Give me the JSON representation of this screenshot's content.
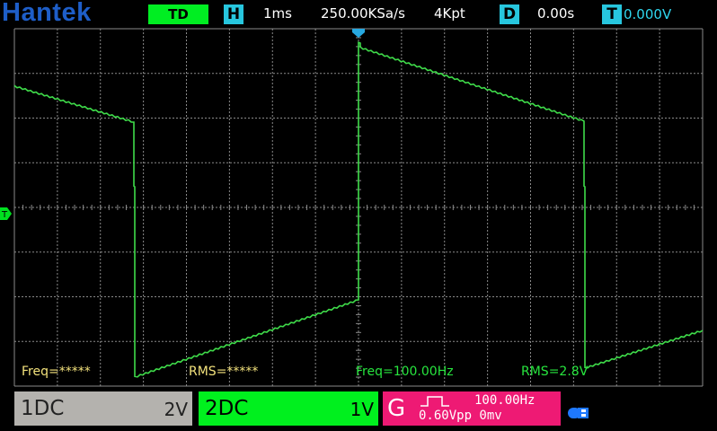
{
  "header": {
    "brand": "Hantek",
    "mode": "TD",
    "timebase_letter": "H",
    "timebase": "1ms",
    "sample_rate": "250.00KSa/s",
    "memory_depth": "4Kpt",
    "delay_letter": "D",
    "delay": "0.00s",
    "trigger_letter": "T",
    "trigger_level": "0.000V"
  },
  "measurements": {
    "ch1_freq": "Freq=*****",
    "ch1_rms": "RMS=*****",
    "ch2_freq": "Freq=100.00Hz",
    "ch2_rms": "RMS=2.8V"
  },
  "channels": [
    {
      "name": "1DC",
      "scale": "2V",
      "color": "#b4b2ae"
    },
    {
      "name": "2DC",
      "scale": "1V",
      "color": "#00f01e"
    }
  ],
  "generator": {
    "letter": "G",
    "frequency": "100.00Hz",
    "amplitude": "0.60Vpp 0mv",
    "color": "#ee1a74"
  },
  "markers": {
    "trigger_marker": "T"
  },
  "colors": {
    "trace": "#3fdc4a",
    "grid": "#8a8a8a",
    "brand": "#1e5ec8",
    "accent_cyan": "#27c6de"
  },
  "icons": {
    "status": "usb-link-icon",
    "generator_wave": "square-wave-icon"
  }
}
